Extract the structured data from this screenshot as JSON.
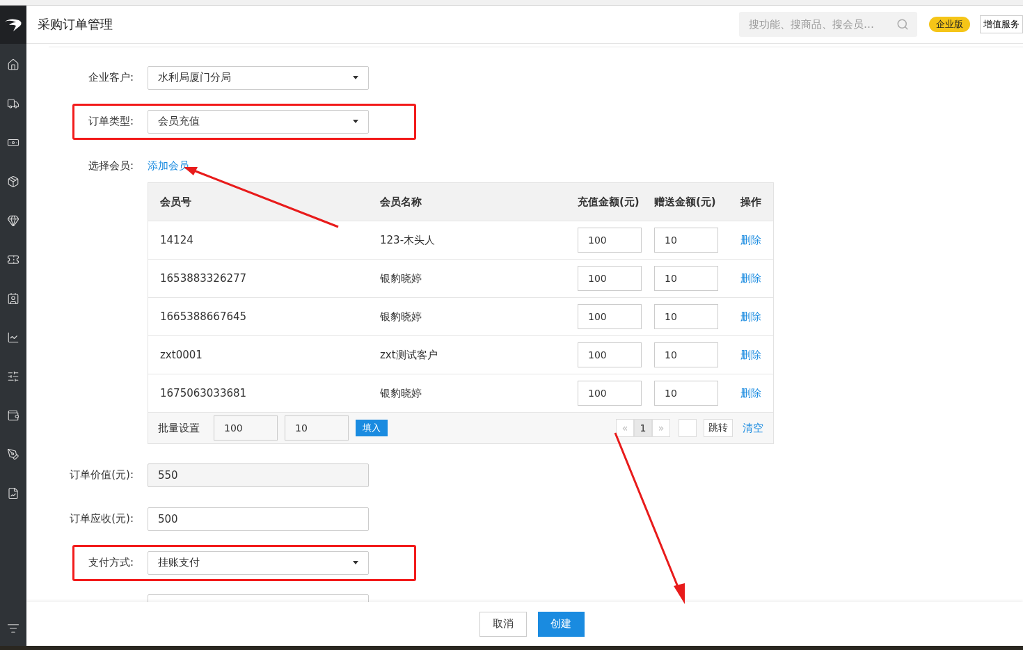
{
  "header": {
    "title": "采购订单管理",
    "search": {
      "placeholder": "搜功能、搜商品、搜会员…"
    },
    "edition_badge": "企业版",
    "service_button": "增值服务"
  },
  "fields": [
    {
      "kind": "select",
      "label": "企业客户:",
      "value": "水利局厦门分局",
      "highlighted": false
    },
    {
      "kind": "select",
      "label": "订单类型:",
      "value": "会员充值",
      "highlighted": true
    },
    {
      "kind": "link",
      "label": "选择会员:",
      "value": "添加会员",
      "highlighted": false
    },
    {
      "kind": "table"
    },
    {
      "kind": "readonly",
      "label": "订单价值(元):",
      "value": "550",
      "highlighted": false
    },
    {
      "kind": "input",
      "label": "订单应收(元):",
      "value": "500",
      "highlighted": false
    },
    {
      "kind": "select",
      "label": "支付方式:",
      "value": "挂账支付",
      "highlighted": true
    },
    {
      "kind": "hidden"
    }
  ],
  "members": {
    "columns": [
      "会员号",
      "会员名称",
      "充值金额(元)",
      "赠送金额(元)",
      "操作"
    ],
    "rows": [
      {
        "id": "14124",
        "name": "123-木头人",
        "recharge": "100",
        "bonus": "10",
        "action": "删除"
      },
      {
        "id": "1653883326277",
        "name": "银豹晓婷",
        "recharge": "100",
        "bonus": "10",
        "action": "删除"
      },
      {
        "id": "1665388667645",
        "name": "银豹晓婷",
        "recharge": "100",
        "bonus": "10",
        "action": "删除"
      },
      {
        "id": "zxt0001",
        "name": "zxt测试客户",
        "recharge": "100",
        "bonus": "10",
        "action": "删除"
      },
      {
        "id": "1675063033681",
        "name": "银豹晓婷",
        "recharge": "100",
        "bonus": "10",
        "action": "删除"
      }
    ],
    "batch": {
      "label": "批量设置",
      "recharge": "100",
      "bonus": "10",
      "fill_button": "填入"
    },
    "pager": {
      "prev": "«",
      "pages": [
        {
          "label": "1",
          "selected": true
        }
      ],
      "next": "»",
      "jump_button": "跳转",
      "clear_link": "清空"
    }
  },
  "footer": {
    "cancel": "取消",
    "create": "创建"
  }
}
